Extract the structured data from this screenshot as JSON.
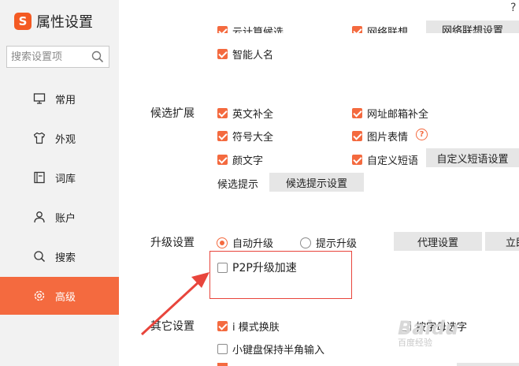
{
  "sidebar": {
    "logo_char": "S",
    "title": "属性设置",
    "search_placeholder": "搜索设置项",
    "items": [
      {
        "label": "常用",
        "icon": "monitor-icon"
      },
      {
        "label": "外观",
        "icon": "shirt-icon"
      },
      {
        "label": "词库",
        "icon": "book-icon"
      },
      {
        "label": "账户",
        "icon": "user-icon"
      },
      {
        "label": "搜索",
        "icon": "search-icon"
      },
      {
        "label": "高级",
        "icon": "gear-icon"
      }
    ],
    "active_index": 5
  },
  "help_label": "?",
  "top_partial": {
    "cloud_calc": "云计算候选",
    "phrase_tips": "网络联想",
    "phrase_button": "网络联想设置"
  },
  "smart_name": "智能人名",
  "candidate_ext": {
    "label": "候选扩展",
    "options": {
      "english_complete": "英文补全",
      "url_email": "网址邮箱补全",
      "symbols": "符号大全",
      "picture_emoji": "图片表情",
      "emoticon": "颜文字",
      "custom_phrase": "自定义短语"
    },
    "custom_phrase_button": "自定义短语设置",
    "hint_label": "候选提示",
    "hint_button": "候选提示设置",
    "help_icon": "?"
  },
  "upgrade": {
    "label": "升级设置",
    "auto": "自动升级",
    "prompt": "提示升级",
    "proxy_button": "代理设置",
    "now_button": "立即",
    "p2p": "P2P升级加速"
  },
  "other": {
    "label": "其它设置",
    "i_mode": "i 模式换肤",
    "half_width": "小键盘保持半角输入",
    "letter_select": "按字母选字"
  },
  "watermark": {
    "logo": "Baidu",
    "sub": "百度经验"
  },
  "colors": {
    "accent": "#f46a3f",
    "sidebar_bg": "#f2f2f2",
    "arrow": "#e8453c"
  }
}
